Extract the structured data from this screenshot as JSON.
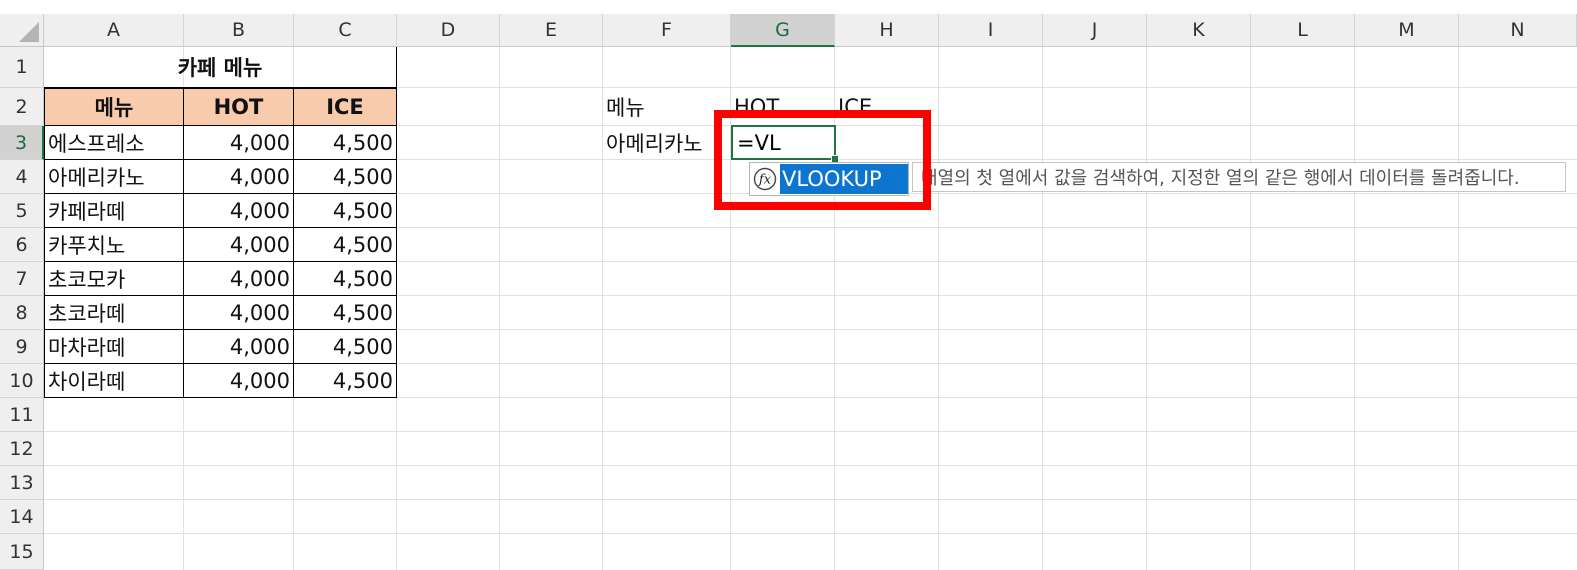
{
  "columns": [
    "A",
    "B",
    "C",
    "D",
    "E",
    "F",
    "G",
    "H",
    "I",
    "J",
    "K",
    "L",
    "M",
    "N"
  ],
  "rows": [
    "1",
    "2",
    "3",
    "4",
    "5",
    "6",
    "7",
    "8",
    "9",
    "10",
    "11",
    "12",
    "13",
    "14",
    "15"
  ],
  "table": {
    "title": "카페 메뉴",
    "headers": [
      "메뉴",
      "HOT",
      "ICE"
    ],
    "items": [
      {
        "name": "에스프레소",
        "hot": "4,000",
        "ice": "4,500"
      },
      {
        "name": "아메리카노",
        "hot": "4,000",
        "ice": "4,500"
      },
      {
        "name": "카페라떼",
        "hot": "4,000",
        "ice": "4,500"
      },
      {
        "name": "카푸치노",
        "hot": "4,000",
        "ice": "4,500"
      },
      {
        "name": "초코모카",
        "hot": "4,000",
        "ice": "4,500"
      },
      {
        "name": "초코라떼",
        "hot": "4,000",
        "ice": "4,500"
      },
      {
        "name": "마차라떼",
        "hot": "4,000",
        "ice": "4,500"
      },
      {
        "name": "차이라떼",
        "hot": "4,000",
        "ice": "4,500"
      }
    ]
  },
  "lookup": {
    "f2": "메뉴",
    "g2": "HOT",
    "h2": "ICE",
    "f3": "아메리카노"
  },
  "active_cell": {
    "ref": "G3",
    "input": "=VL"
  },
  "autocomplete": {
    "suggestion": "VLOOKUP",
    "icon": "function-icon"
  },
  "tooltip": "배열의 첫 열에서 값을 검색하여, 지정한 열의 같은 행에서 데이터를 돌려줍니다.",
  "colors": {
    "header_fill": "#f8cbad",
    "selection": "#217346",
    "highlight": "#ff0000",
    "autocomplete_bg": "#0b75cf"
  }
}
